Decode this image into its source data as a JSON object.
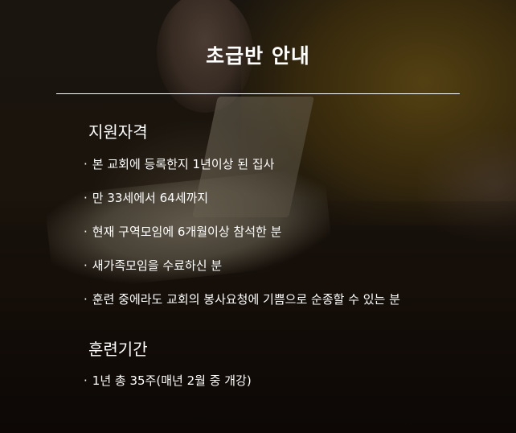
{
  "title": "초급반 안내",
  "sections": [
    {
      "heading": "지원자격",
      "items": [
        "본 교회에 등록한지 1년이상 된 집사",
        "만 33세에서 64세까지",
        "현재 구역모임에 6개월이상 참석한 분",
        "새가족모임을 수료하신 분",
        "훈련 중에라도 교회의 봉사요청에 기쁨으로 순종할 수 있는 분"
      ]
    },
    {
      "heading": "훈련기간",
      "items": [
        "1년 총 35주(매년 2월 중 개강)"
      ]
    }
  ],
  "bullet": "·",
  "colors": {
    "text": "#ffffff",
    "background": "#2a2118",
    "accent": "#8a6a1e"
  }
}
